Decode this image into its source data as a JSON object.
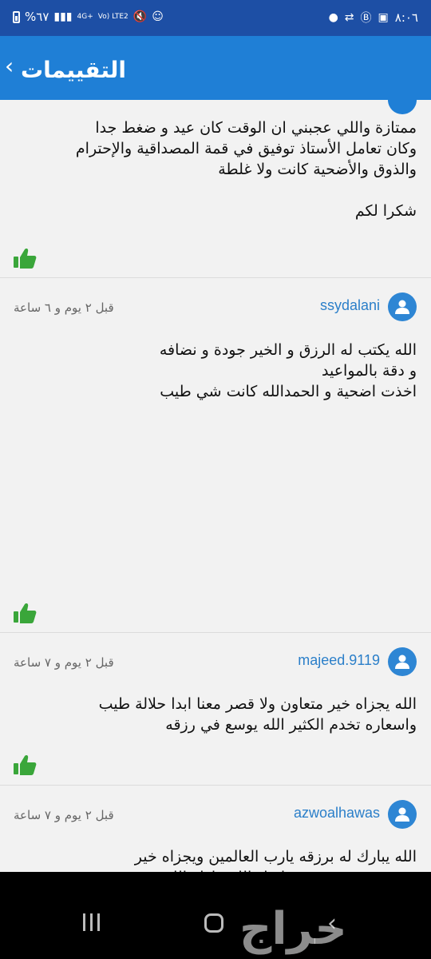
{
  "status_bar": {
    "battery_text": "%٦٧",
    "network": "4G+",
    "volte": "Vo) LTE2",
    "time": "٨:٠٦"
  },
  "header": {
    "title": "التقييمات"
  },
  "reviews": [
    {
      "username": "",
      "time": "",
      "text": "ممتازة واللي عجبني ان الوقت كان عيد و ضغط جدا\nوكان تعامل الأستاذ توفيق في قمة المصداقية والإحترام\nوالذوق والأضحية كانت ولا غلطة\n\nشكرا لكم"
    },
    {
      "username": "ssydalani",
      "time": "قبل ٢ يوم و ٦ ساعة",
      "text": "الله يكتب له الرزق و الخير   جودة و نضافه\nو دقة بالمواعيد\nاخذت اضحية و الحمدالله كانت شي طيب"
    },
    {
      "username": "majeed.9119",
      "time": "قبل ٢ يوم و ٧ ساعة",
      "text": "الله يجزاه خير متعاون ولا قصر معنا ابدا  حلالة طيب\nواسعاره تخدم الكثير الله يوسع في رزقه"
    },
    {
      "username": "azwoalhawas",
      "time": "قبل ٢ يوم و ٧ ساعة",
      "text": "الله يبارك له برزقه يارب العالمين ويجزاه خير\nجودة وسعر وخدمة ماشاء الله تبارك الله"
    }
  ],
  "watermark": "حراج",
  "colors": {
    "status_bar": "#1d4fa5",
    "app_bar": "#1f7fd6",
    "username": "#2b7fc9",
    "like": "#3aa63a"
  },
  "icons": {
    "back": "chevron-left-icon",
    "avatar": "user-icon",
    "like": "thumbs-up-icon"
  }
}
